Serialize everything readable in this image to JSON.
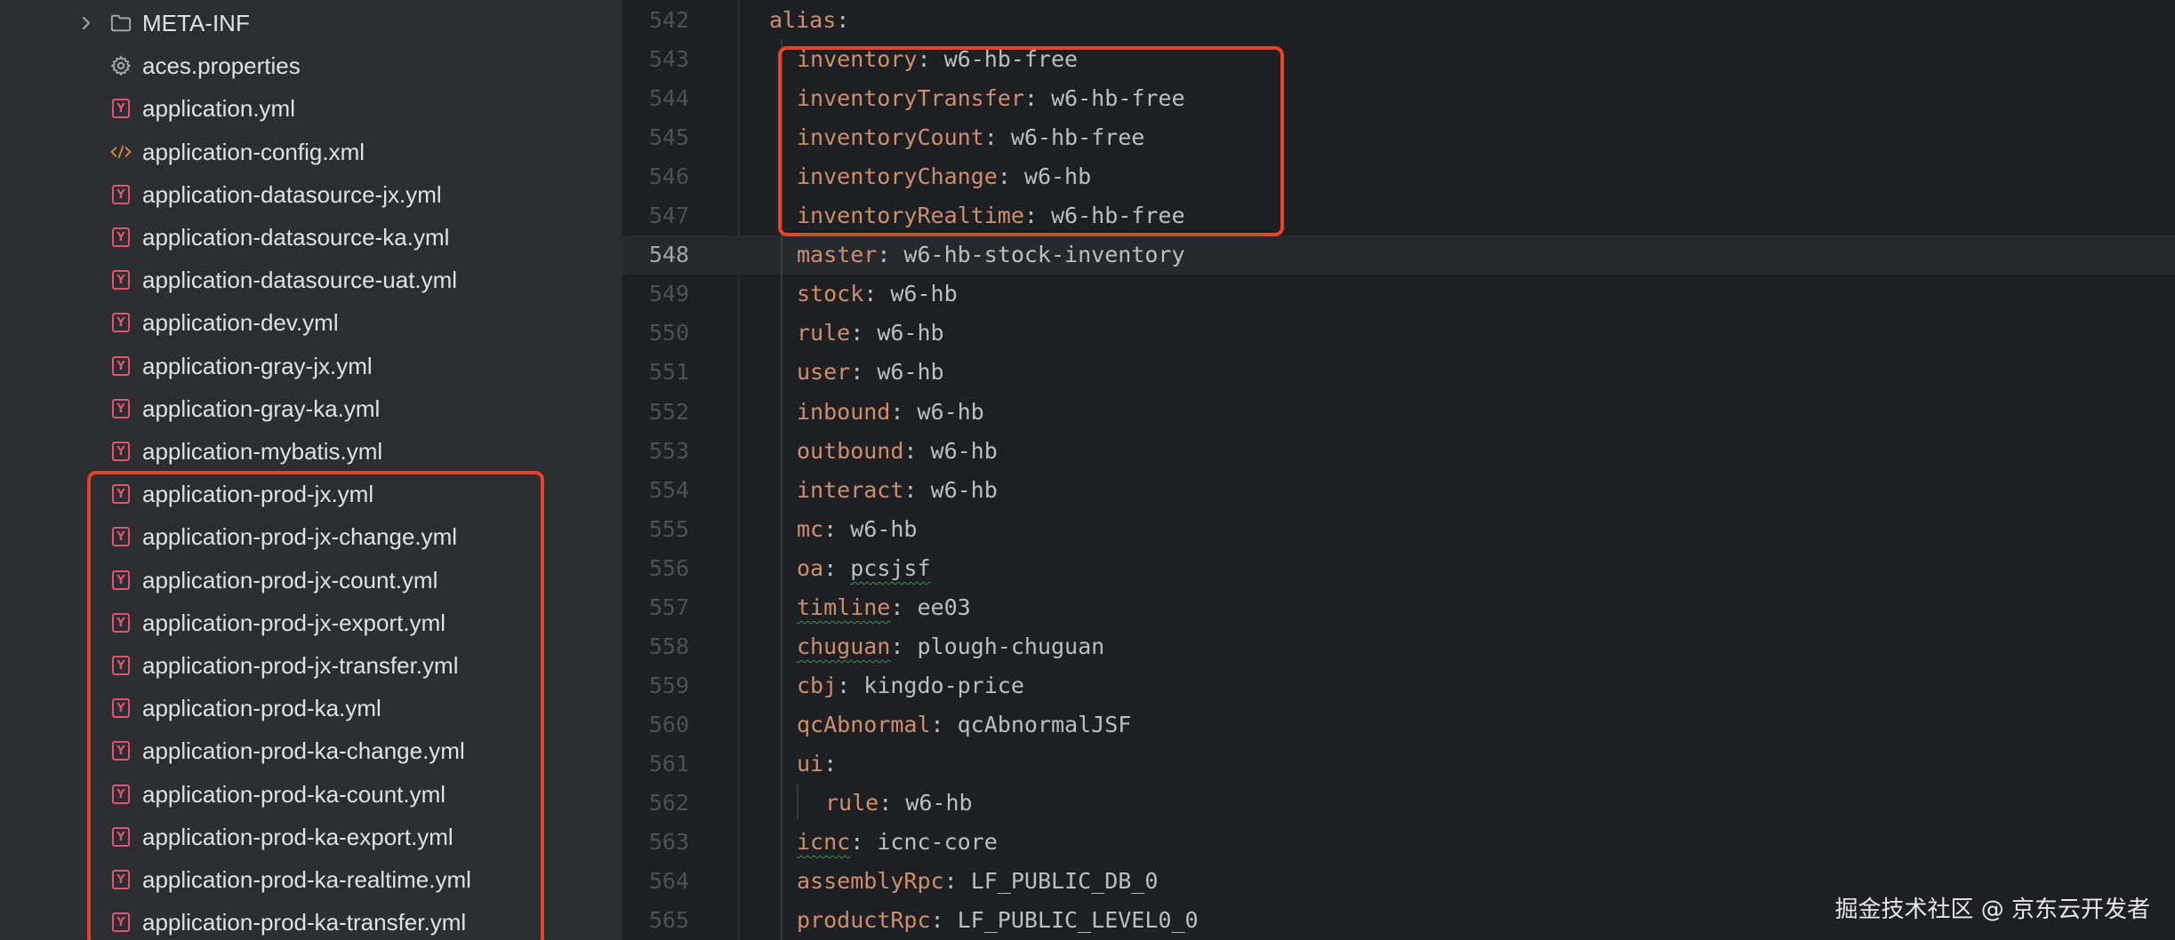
{
  "tree": {
    "items": [
      {
        "label": "META-INF",
        "icon": "folder-icon",
        "chevron": true
      },
      {
        "label": "aces.properties",
        "icon": "gear-icon"
      },
      {
        "label": "application.yml",
        "icon": "yml-icon"
      },
      {
        "label": "application-config.xml",
        "icon": "xml-icon"
      },
      {
        "label": "application-datasource-jx.yml",
        "icon": "yml-icon"
      },
      {
        "label": "application-datasource-ka.yml",
        "icon": "yml-icon"
      },
      {
        "label": "application-datasource-uat.yml",
        "icon": "yml-icon"
      },
      {
        "label": "application-dev.yml",
        "icon": "yml-icon"
      },
      {
        "label": "application-gray-jx.yml",
        "icon": "yml-icon"
      },
      {
        "label": "application-gray-ka.yml",
        "icon": "yml-icon"
      },
      {
        "label": "application-mybatis.yml",
        "icon": "yml-icon"
      },
      {
        "label": "application-prod-jx.yml",
        "icon": "yml-icon"
      },
      {
        "label": "application-prod-jx-change.yml",
        "icon": "yml-icon"
      },
      {
        "label": "application-prod-jx-count.yml",
        "icon": "yml-icon"
      },
      {
        "label": "application-prod-jx-export.yml",
        "icon": "yml-icon"
      },
      {
        "label": "application-prod-jx-transfer.yml",
        "icon": "yml-icon"
      },
      {
        "label": "application-prod-ka.yml",
        "icon": "yml-icon"
      },
      {
        "label": "application-prod-ka-change.yml",
        "icon": "yml-icon"
      },
      {
        "label": "application-prod-ka-count.yml",
        "icon": "yml-icon"
      },
      {
        "label": "application-prod-ka-export.yml",
        "icon": "yml-icon"
      },
      {
        "label": "application-prod-ka-realtime.yml",
        "icon": "yml-icon"
      },
      {
        "label": "application-prod-ka-transfer.yml",
        "icon": "yml-icon"
      }
    ],
    "icon_glyph_yml": "Y"
  },
  "editor": {
    "current_line": 548,
    "lines": [
      {
        "n": "542",
        "indent": 0,
        "key": "alias",
        "val": ""
      },
      {
        "n": "543",
        "indent": 1,
        "key": "inventory",
        "val": "w6-hb-free"
      },
      {
        "n": "544",
        "indent": 1,
        "key": "inventoryTransfer",
        "val": "w6-hb-free"
      },
      {
        "n": "545",
        "indent": 1,
        "key": "inventoryCount",
        "val": "w6-hb-free"
      },
      {
        "n": "546",
        "indent": 1,
        "key": "inventoryChange",
        "val": "w6-hb"
      },
      {
        "n": "547",
        "indent": 1,
        "key": "inventoryRealtime",
        "val": "w6-hb-free"
      },
      {
        "n": "548",
        "indent": 1,
        "key": "master",
        "val": "w6-hb-stock-inventory"
      },
      {
        "n": "549",
        "indent": 1,
        "key": "stock",
        "val": "w6-hb"
      },
      {
        "n": "550",
        "indent": 1,
        "key": "rule",
        "val": "w6-hb"
      },
      {
        "n": "551",
        "indent": 1,
        "key": "user",
        "val": "w6-hb"
      },
      {
        "n": "552",
        "indent": 1,
        "key": "inbound",
        "val": "w6-hb"
      },
      {
        "n": "553",
        "indent": 1,
        "key": "outbound",
        "val": "w6-hb"
      },
      {
        "n": "554",
        "indent": 1,
        "key": "interact",
        "val": "w6-hb"
      },
      {
        "n": "555",
        "indent": 1,
        "key": "mc",
        "val": "w6-hb"
      },
      {
        "n": "556",
        "indent": 1,
        "key": "oa",
        "val": "pcsjsf",
        "squig_val": true
      },
      {
        "n": "557",
        "indent": 1,
        "key": "timline",
        "val": "ee03",
        "squig_key": true
      },
      {
        "n": "558",
        "indent": 1,
        "key": "chuguan",
        "val": "plough-chuguan",
        "squig_key": true
      },
      {
        "n": "559",
        "indent": 1,
        "key": "cbj",
        "val": "kingdo-price"
      },
      {
        "n": "560",
        "indent": 1,
        "key": "qcAbnormal",
        "val": "qcAbnormalJSF"
      },
      {
        "n": "561",
        "indent": 1,
        "key": "ui",
        "val": ""
      },
      {
        "n": "562",
        "indent": 2,
        "key": "rule",
        "val": "w6-hb"
      },
      {
        "n": "563",
        "indent": 1,
        "key": "icnc",
        "val": "icnc-core",
        "squig_key": true
      },
      {
        "n": "564",
        "indent": 1,
        "key": "assemblyRpc",
        "val": "LF_PUBLIC_DB_0"
      },
      {
        "n": "565",
        "indent": 1,
        "key": "productRpc",
        "val": "LF_PUBLIC_LEVEL0_0"
      }
    ]
  },
  "watermark": "掘金技术社区 @ 京东云开发者"
}
